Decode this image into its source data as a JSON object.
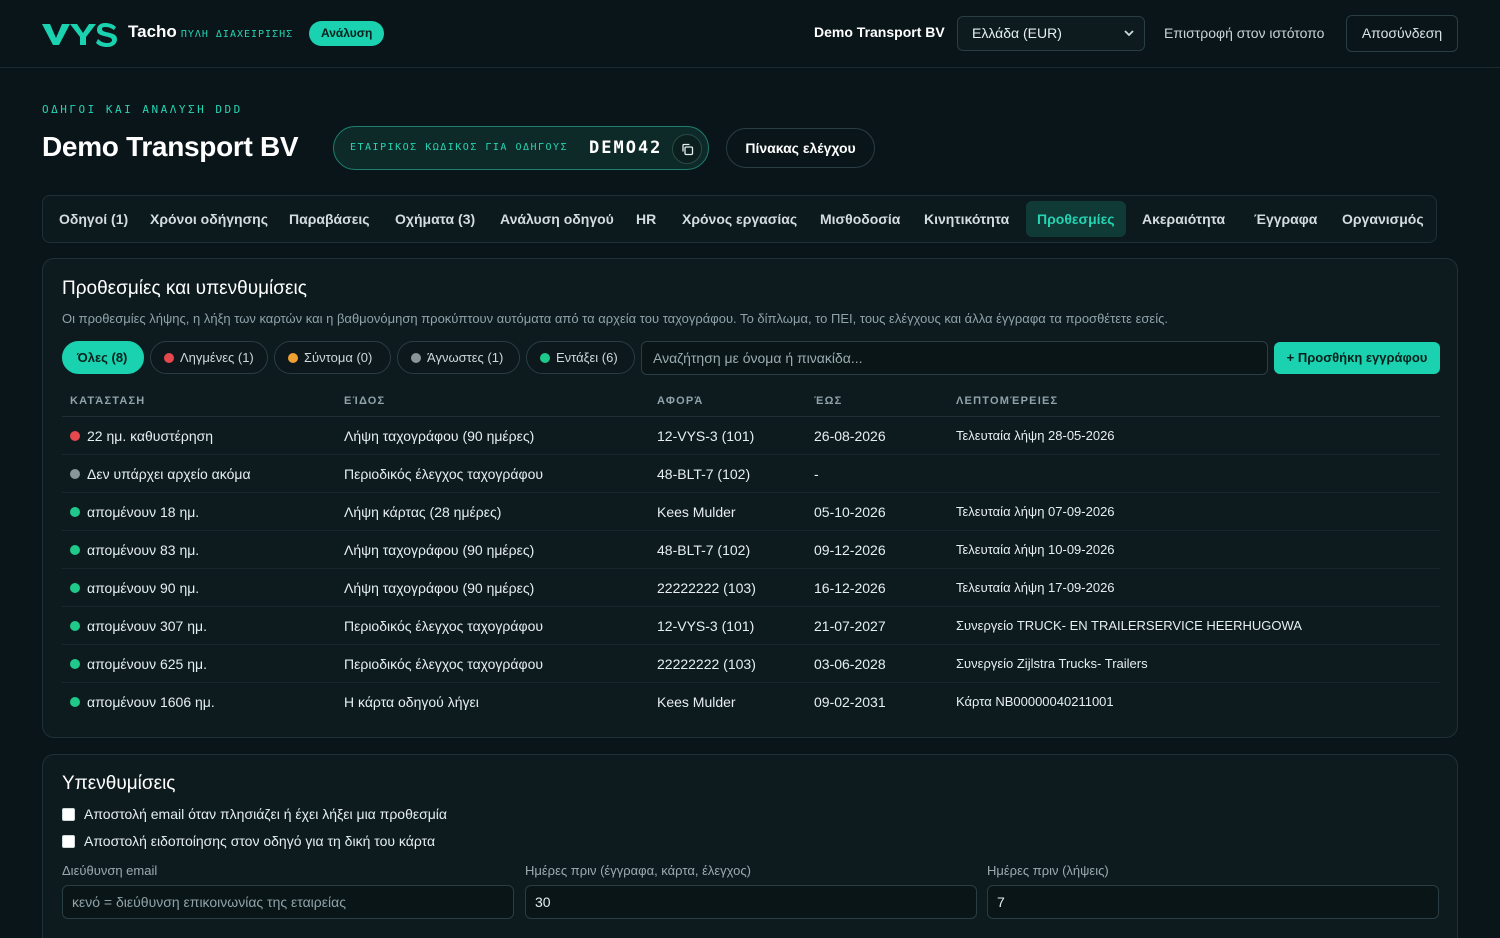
{
  "header": {
    "brand": "Tacho",
    "brand_sub": "ΠΥΛΗ ΔΙΑΧΕΙΡΙΣΗΣ",
    "badge": "Ανάλυση",
    "company": "Demo Transport BV",
    "region": "Ελλάδα (EUR)",
    "back_link": "Επιστροφή στον ιστότοπο",
    "logout": "Αποσύνδεση"
  },
  "page": {
    "kicker": "ΟΔΗΓΟΙ ΚΑΙ ΑΝΑΛΥΣΗ DDD",
    "title": "Demo Transport BV",
    "driver_code_label": "ΕΤΑΙΡΙΚΟΣ ΚΩΔΙΚΟΣ ΓΙΑ ΟΔΗΓΟΥΣ",
    "driver_code": "DEMO42",
    "dashboard_button": "Πίνακας ελέγχου"
  },
  "tabs": [
    {
      "label": "Οδηγοί (1)"
    },
    {
      "label": "Χρόνοι οδήγησης"
    },
    {
      "label": "Παραβάσεις"
    },
    {
      "label": "Οχήματα (3)"
    },
    {
      "label": "Ανάλυση οδηγού"
    },
    {
      "label": "HR"
    },
    {
      "label": "Χρόνος εργασίας"
    },
    {
      "label": "Μισθοδοσία"
    },
    {
      "label": "Κινητικότητα"
    },
    {
      "label": "Προθεσμίες",
      "active": true
    },
    {
      "label": "Ακεραιότητα"
    },
    {
      "label": "Έγγραφα"
    },
    {
      "label": "Οργανισμός"
    }
  ],
  "deadlines": {
    "title": "Προθεσμίες και υπενθυμίσεις",
    "description": "Οι προθεσμίες λήψης, η λήξη των καρτών και η βαθμονόμηση προκύπτουν αυτόματα από τα αρχεία του ταχογράφου. Το δίπλωμα, το ΠΕΙ, τους ελέγχους και άλλα έγγραφα τα προσθέτετε εσείς.",
    "filters": [
      {
        "label": "Όλες (8)",
        "active": true
      },
      {
        "label": "Ληγμένες (1)",
        "color": "#e5484d"
      },
      {
        "label": "Σύντομα (0)",
        "color": "#f0a030"
      },
      {
        "label": "Άγνωστες (1)",
        "color": "#8a9599"
      },
      {
        "label": "Εντάξει (6)",
        "color": "#1ec98a"
      }
    ],
    "search_placeholder": "Αναζήτηση με όνομα ή πινακίδα...",
    "add_button": "+ Προσθήκη εγγράφου",
    "columns": [
      "ΚΑΤΆΣΤΑΣΗ",
      "ΕΊΔΟΣ",
      "ΑΦΟΡΆ",
      "ΈΩΣ",
      "ΛΕΠΤΟΜΈΡΕΙΕΣ"
    ],
    "rows": [
      {
        "status": "22 ημ. καθυστέρηση",
        "color": "#e5484d",
        "type": "Λήψη ταχογράφου (90 ημέρες)",
        "subject": "12-VYS-3 (101)",
        "until": "26-08-2026",
        "details": "Τελευταία λήψη 28-05-2026"
      },
      {
        "status": "Δεν υπάρχει αρχείο ακόμα",
        "color": "#8a9599",
        "type": "Περιοδικός έλεγχος ταχογράφου",
        "subject": "48-BLT-7 (102)",
        "until": "-",
        "details": ""
      },
      {
        "status": "απομένουν 18 ημ.",
        "color": "#1ec98a",
        "type": "Λήψη κάρτας (28 ημέρες)",
        "subject": "Kees Mulder",
        "until": "05-10-2026",
        "details": "Τελευταία λήψη 07-09-2026"
      },
      {
        "status": "απομένουν 83 ημ.",
        "color": "#1ec98a",
        "type": "Λήψη ταχογράφου (90 ημέρες)",
        "subject": "48-BLT-7 (102)",
        "until": "09-12-2026",
        "details": "Τελευταία λήψη 10-09-2026"
      },
      {
        "status": "απομένουν 90 ημ.",
        "color": "#1ec98a",
        "type": "Λήψη ταχογράφου (90 ημέρες)",
        "subject": "22222222 (103)",
        "until": "16-12-2026",
        "details": "Τελευταία λήψη 17-09-2026"
      },
      {
        "status": "απομένουν 307 ημ.",
        "color": "#1ec98a",
        "type": "Περιοδικός έλεγχος ταχογράφου",
        "subject": "12-VYS-3 (101)",
        "until": "21-07-2027",
        "details": "Συνεργείο TRUCK- EN TRAILERSERVICE HEERHUGOWA"
      },
      {
        "status": "απομένουν 625 ημ.",
        "color": "#1ec98a",
        "type": "Περιοδικός έλεγχος ταχογράφου",
        "subject": "22222222 (103)",
        "until": "03-06-2028",
        "details": "Συνεργείο Zijlstra Trucks- Trailers"
      },
      {
        "status": "απομένουν 1606 ημ.",
        "color": "#1ec98a",
        "type": "Η κάρτα οδηγού λήγει",
        "subject": "Kees Mulder",
        "until": "09-02-2031",
        "details": "Κάρτα NB00000040211001"
      }
    ]
  },
  "reminders": {
    "title": "Υπενθυμίσεις",
    "checkbox_email": "Αποστολή email όταν πλησιάζει ή έχει λήξει μια προθεσμία",
    "checkbox_driver": "Αποστολή ειδοποίησης στον οδηγό για τη δική του κάρτα",
    "email_label": "Διεύθυνση email",
    "email_placeholder": "κενό = διεύθυνση επικοινωνίας της εταιρείας",
    "days_docs_label": "Ημέρες πριν (έγγραφα, κάρτα, έλεγχος)",
    "days_docs_value": "30",
    "days_downloads_label": "Ημέρες πριν (λήψεις)",
    "days_downloads_value": "7"
  }
}
